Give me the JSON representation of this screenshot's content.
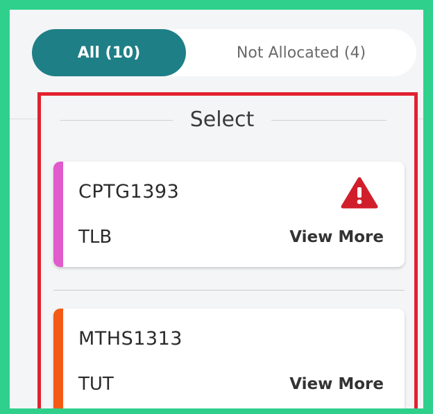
{
  "tabs": {
    "all_label": "All (10)",
    "not_allocated_label": "Not Allocated (4)"
  },
  "select": {
    "title": "Select"
  },
  "colors": {
    "frame": "#2ed08c",
    "highlight": "#e1212f",
    "tab_active": "#1f7f86",
    "warning": "#d01f2b"
  },
  "cards": [
    {
      "code": "CPTG1393",
      "type": "TLB",
      "more_label": "View More",
      "accent_color": "#e05bcb",
      "icon": "warning-icon"
    },
    {
      "code": "MTHS1313",
      "type": "TUT",
      "more_label": "View More",
      "accent_color": "#f45a16",
      "icon": ""
    }
  ]
}
